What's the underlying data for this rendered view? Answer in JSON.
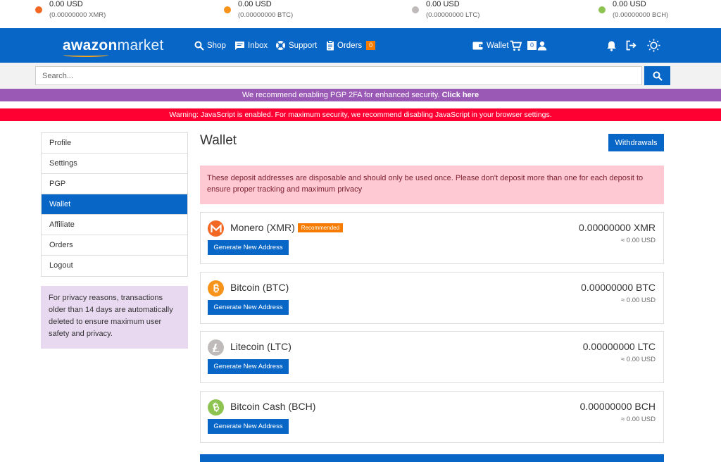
{
  "ticker": [
    {
      "usd": "0.00 USD",
      "amount": "(0.00000000 XMR)",
      "color": "#f26822"
    },
    {
      "usd": "0.00 USD",
      "amount": "(0.00000000 BTC)",
      "color": "#f7931a"
    },
    {
      "usd": "0.00 USD",
      "amount": "(0.00000000 LTC)",
      "color": "#bfbbbb"
    },
    {
      "usd": "0.00 USD",
      "amount": "(0.00000000 BCH)",
      "color": "#8dc351"
    }
  ],
  "nav": {
    "logo_bold": "awazon",
    "logo_light": "market",
    "shop": "Shop",
    "inbox": "Inbox",
    "support": "Support",
    "orders": "Orders",
    "orders_count": "0",
    "wallet": "Wallet",
    "cart_count": "0"
  },
  "search": {
    "placeholder": "Search..."
  },
  "banners": {
    "pgp_text": "We recommend enabling PGP 2FA for enhanced security.",
    "pgp_link": "Click here",
    "js_warning": "Warning: JavaScript is enabled. For maximum security, we recommend disabling JavaScript in your browser settings."
  },
  "sidebar": {
    "items": [
      {
        "label": "Profile"
      },
      {
        "label": "Settings"
      },
      {
        "label": "PGP"
      },
      {
        "label": "Wallet"
      },
      {
        "label": "Affiliate"
      },
      {
        "label": "Orders"
      },
      {
        "label": "Logout"
      }
    ],
    "privacy_note": "For privacy reasons, transactions older than 14 days are automatically deleted to ensure maximum user safety and privacy."
  },
  "main": {
    "title": "Wallet",
    "withdrawals": "Withdrawals",
    "alert": "These deposit addresses are disposable and should only be used once. Please don't deposit more than one for each deposit to ensure proper tracking and maximum privacy",
    "coins": [
      {
        "name": "Monero (XMR)",
        "badge": "Recommended",
        "button": "Generate New Address",
        "balance": "0.00000000 XMR",
        "usd": "≈ 0.00 USD",
        "color": "#f26822"
      },
      {
        "name": "Bitcoin (BTC)",
        "button": "Generate New Address",
        "balance": "0.00000000 BTC",
        "usd": "≈ 0.00 USD",
        "color": "#f7931a"
      },
      {
        "name": "Litecoin (LTC)",
        "button": "Generate New Address",
        "balance": "0.00000000 LTC",
        "usd": "≈ 0.00 USD",
        "color": "#bfbbbb"
      },
      {
        "name": "Bitcoin Cash (BCH)",
        "button": "Generate New Address",
        "balance": "0.00000000 BCH",
        "usd": "≈ 0.00 USD",
        "color": "#8dc351"
      }
    ]
  },
  "colors": {
    "primary": "#0866c6",
    "accent": "#f57c00",
    "pgp_banner": "#9b59b6",
    "js_banner": "#ff0033"
  }
}
